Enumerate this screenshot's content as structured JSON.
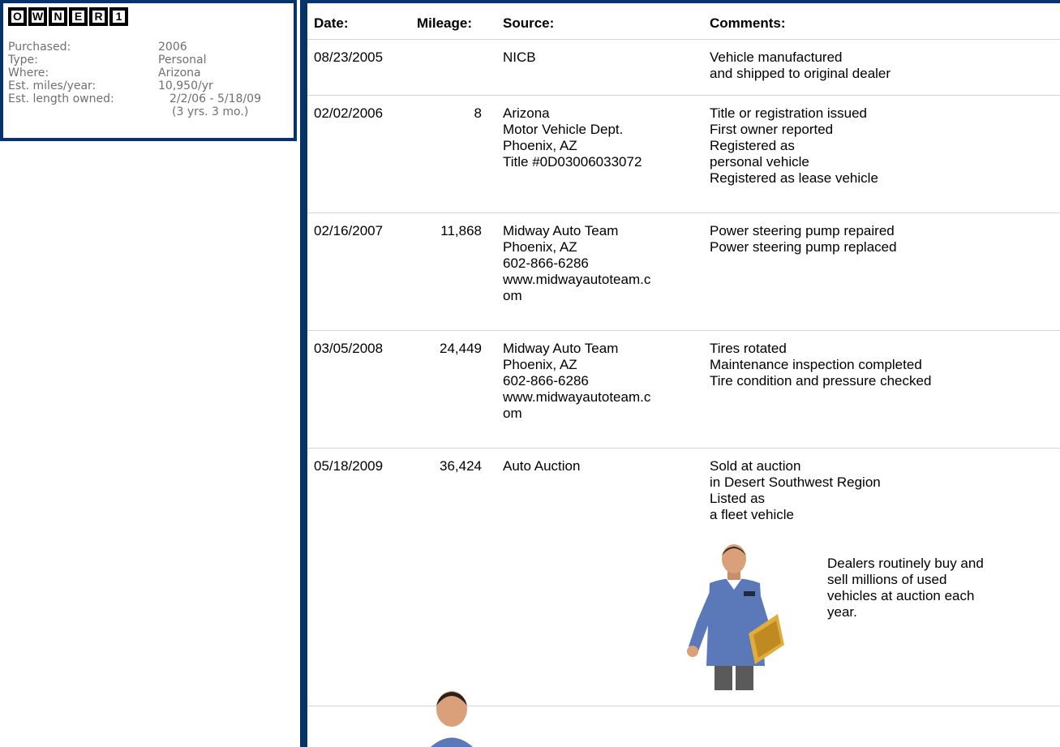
{
  "owner": {
    "logo_letters": [
      "O",
      "W",
      "N",
      "E",
      "R",
      "1"
    ],
    "fields": [
      {
        "label": "Purchased:",
        "value": "2006"
      },
      {
        "label": "Type:",
        "value": "Personal"
      },
      {
        "label": "Where:",
        "value": "Arizona"
      },
      {
        "label": "Est. miles/year:",
        "value": "10,950/yr"
      },
      {
        "label": "Est. length owned:",
        "value": "2/2/06 - 5/18/09"
      }
    ],
    "length_note": "(3 yrs. 3 mo.)"
  },
  "table": {
    "headers": {
      "date": "Date:",
      "mileage": "Mileage:",
      "source": "Source:",
      "comments": "Comments:"
    },
    "events": [
      {
        "date": "08/23/2005",
        "mileage": "",
        "source": [
          "NICB"
        ],
        "comments": [
          "Vehicle manufactured",
          "and shipped to original dealer"
        ]
      },
      {
        "date": "02/02/2006",
        "mileage": "8",
        "source": [
          "Arizona",
          "Motor Vehicle Dept.",
          "Phoenix, AZ",
          "Title #0D03006033072"
        ],
        "comments": [
          "Title or registration issued",
          "First owner reported",
          "Registered as",
          "personal vehicle",
          "Registered as lease vehicle"
        ]
      },
      {
        "date": "02/16/2007",
        "mileage": "11,868",
        "source": [
          "Midway Auto Team",
          "Phoenix, AZ",
          "602-866-6286",
          "www.midwayautoteam.c",
          "om"
        ],
        "comments": [
          "Power steering pump repaired",
          "Power steering pump replaced"
        ]
      },
      {
        "date": "03/05/2008",
        "mileage": "24,449",
        "source": [
          "Midway Auto Team",
          "Phoenix, AZ",
          "602-866-6286",
          "www.midwayautoteam.c",
          "om"
        ],
        "comments": [
          "Tires rotated",
          "Maintenance inspection completed",
          "Tire condition and pressure checked"
        ]
      },
      {
        "date": "05/18/2009",
        "mileage": "36,424",
        "source": [
          "Auto Auction"
        ],
        "comments": [
          "Sold at auction",
          "in Desert Southwest Region",
          "Listed as",
          "a fleet vehicle"
        ]
      }
    ],
    "auction_note": [
      "Dealers routinely buy and",
      "sell millions of used",
      "vehicles at auction each",
      "year."
    ]
  },
  "colors": {
    "frame": "#063369",
    "muted_text": "#6f6f6f",
    "divider": "#d4d4d4",
    "shirt": "#5b78b8"
  },
  "icons": {
    "advisor": "advisor-figure-icon"
  }
}
